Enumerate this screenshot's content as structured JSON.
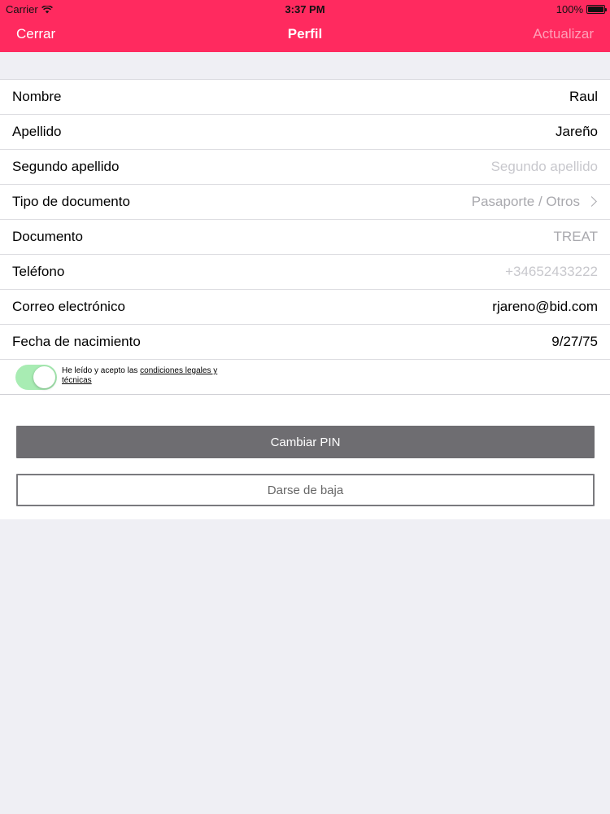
{
  "status_bar": {
    "carrier": "Carrier",
    "time": "3:37 PM",
    "battery": "100%"
  },
  "nav": {
    "left_label": "Cerrar",
    "title": "Perfil",
    "right_label": "Actualizar"
  },
  "form": {
    "rows": [
      {
        "label": "Nombre",
        "value": "Raul"
      },
      {
        "label": "Apellido",
        "value": "Jareño"
      },
      {
        "label": "Segundo apellido",
        "placeholder": "Segundo apellido"
      },
      {
        "label": "Tipo de documento",
        "value": "Pasaporte / Otros"
      },
      {
        "label": "Documento",
        "value": "TREAT"
      },
      {
        "label": "Teléfono",
        "placeholder": "+34652433222"
      },
      {
        "label": "Correo electrónico",
        "value": "rjareno@bid.com"
      },
      {
        "label": "Fecha de nacimiento",
        "value": "9/27/75"
      }
    ],
    "legal": {
      "toggle_on": true,
      "text_prefix": "He leído y acepto las ",
      "link_text": "condiciones legales y técnicas"
    }
  },
  "actions": {
    "change_pin_label": "Cambiar PIN",
    "unsubscribe_label": "Darse de baja"
  },
  "colors": {
    "brand": "#ff2a5f",
    "toggle_on": "#a8ecb3",
    "primary_button": "#6e6d71"
  }
}
